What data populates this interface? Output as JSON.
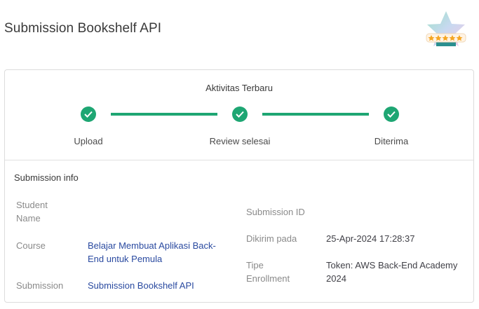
{
  "page": {
    "title": "Submission Bookshelf API"
  },
  "badge": {
    "icon": "star-rating-badge-icon",
    "stars": 5
  },
  "activity": {
    "title": "Aktivitas Terbaru",
    "steps": [
      {
        "label": "Upload",
        "status": "done"
      },
      {
        "label": "Review selesai",
        "status": "done"
      },
      {
        "label": "Diterima",
        "status": "done"
      }
    ]
  },
  "submission_info": {
    "title": "Submission info",
    "student_name": {
      "label": "Student Name",
      "value": ""
    },
    "course": {
      "label": "Course",
      "value": "Belajar Membuat Aplikasi Back-End untuk Pemula"
    },
    "submission": {
      "label": "Submission",
      "value": "Submission Bookshelf API"
    },
    "submission_id": {
      "label": "Submission ID",
      "value": ""
    },
    "submitted_at": {
      "label": "Dikirim pada",
      "value": "25-Apr-2024 17:28:37"
    },
    "enrollment_type": {
      "label": "Tipe Enrollment",
      "value": "Token: AWS Back-End Academy 2024"
    }
  },
  "colors": {
    "accent": "#1ea673",
    "link": "#2a4aa0"
  }
}
